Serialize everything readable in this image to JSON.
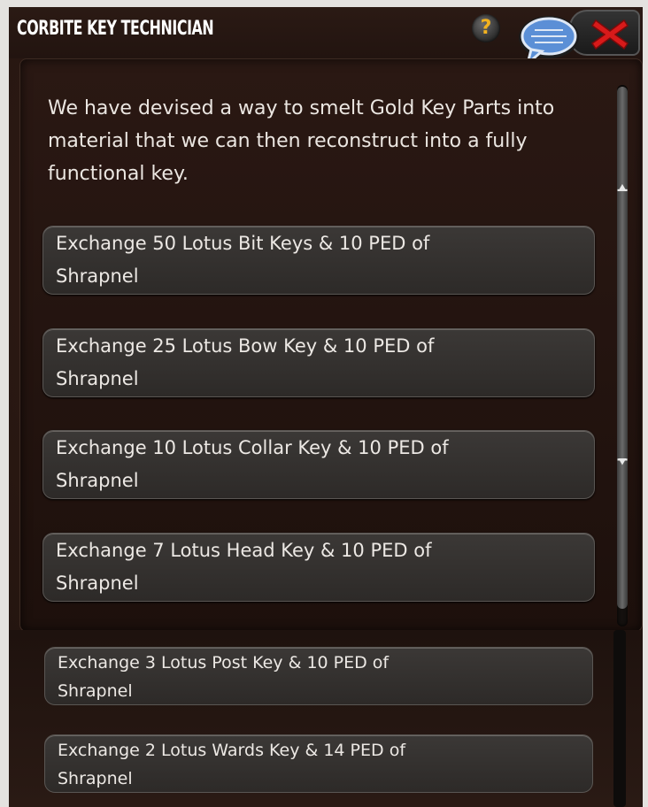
{
  "window": {
    "title": "CORBITE KEY TECHNICIAN",
    "help_glyph": "?",
    "icons": {
      "help": "help-icon",
      "chat": "chat-bubble-icon",
      "close": "close-icon"
    },
    "colors": {
      "title_text": "#ffffff",
      "help_accent": "#f2b21f",
      "close_red": "#d81a1a",
      "chat_blue": "#5b8fd6"
    }
  },
  "dialog": {
    "description": "We have devised a way to smelt Gold Key Parts into material that we can then reconstruct into a fully functional key."
  },
  "options": [
    {
      "line1": "Exchange 50 Lotus Bit Keys & 10 PED of",
      "line2": "Shrapnel"
    },
    {
      "line1": "Exchange 25 Lotus Bow Key & 10 PED of",
      "line2": "Shrapnel"
    },
    {
      "line1": "Exchange 10  Lotus Collar Key & 10 PED of",
      "line2": "Shrapnel"
    },
    {
      "line1": "Exchange 7  Lotus Head Key & 10 PED of",
      "line2": "Shrapnel"
    },
    {
      "line1": "Exchange 3 Lotus Post Key & 10 PED of",
      "line2": "Shrapnel"
    },
    {
      "line1": "Exchange 2 Lotus Wards Key & 14 PED of",
      "line2": "Shrapnel"
    }
  ]
}
